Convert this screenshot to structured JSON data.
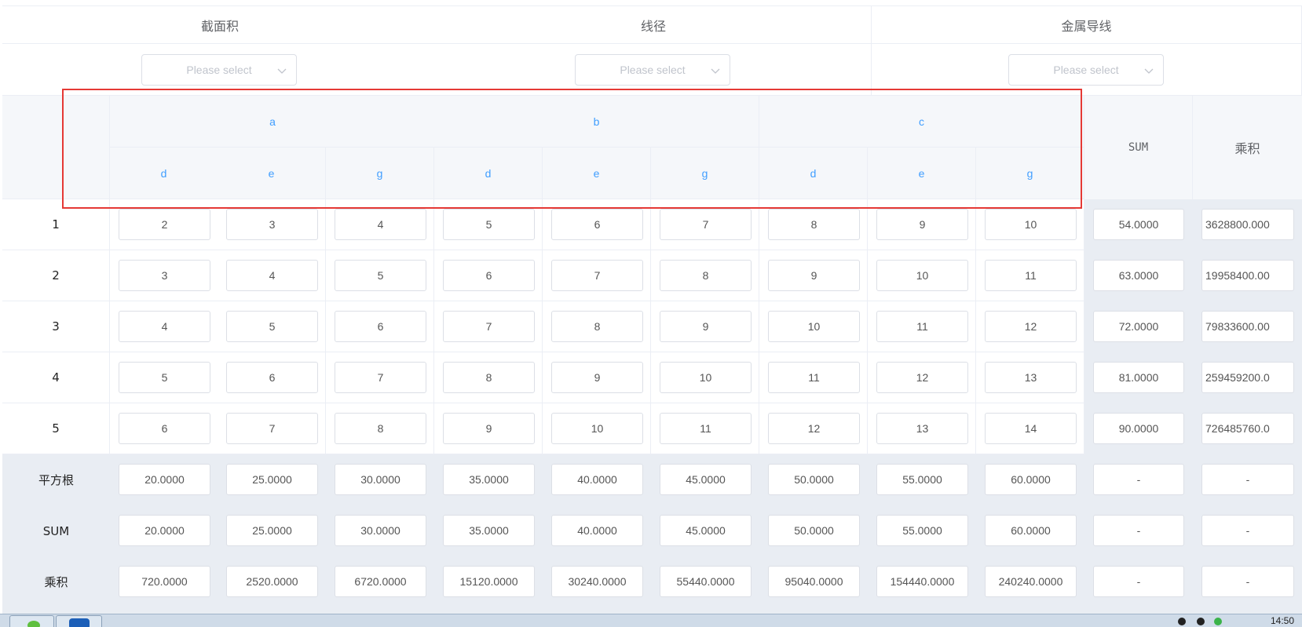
{
  "top_headers": [
    "截面积",
    "线径",
    "金属导线"
  ],
  "filter_placeholder": "Please select",
  "group_headers": [
    "a",
    "b",
    "c"
  ],
  "sub_headers": [
    "d",
    "e",
    "g",
    "d",
    "e",
    "g",
    "d",
    "e",
    "g"
  ],
  "sum_header": "SUM",
  "product_header": "乘积",
  "rows": [
    {
      "label": "1",
      "values": [
        "2",
        "3",
        "4",
        "5",
        "6",
        "7",
        "8",
        "9",
        "10"
      ],
      "sum": "54.0000",
      "product": "3628800.000"
    },
    {
      "label": "2",
      "values": [
        "3",
        "4",
        "5",
        "6",
        "7",
        "8",
        "9",
        "10",
        "11"
      ],
      "sum": "63.0000",
      "product": "19958400.00"
    },
    {
      "label": "3",
      "values": [
        "4",
        "5",
        "6",
        "7",
        "8",
        "9",
        "10",
        "11",
        "12"
      ],
      "sum": "72.0000",
      "product": "79833600.00"
    },
    {
      "label": "4",
      "values": [
        "5",
        "6",
        "7",
        "8",
        "9",
        "10",
        "11",
        "12",
        "13"
      ],
      "sum": "81.0000",
      "product": "259459200.0"
    },
    {
      "label": "5",
      "values": [
        "6",
        "7",
        "8",
        "9",
        "10",
        "11",
        "12",
        "13",
        "14"
      ],
      "sum": "90.0000",
      "product": "726485760.0"
    }
  ],
  "summary_rows": [
    {
      "label": "平方根",
      "values": [
        "20.0000",
        "25.0000",
        "30.0000",
        "35.0000",
        "40.0000",
        "45.0000",
        "50.0000",
        "55.0000",
        "60.0000"
      ],
      "sum": "-",
      "product": "-"
    },
    {
      "label": "SUM",
      "values": [
        "20.0000",
        "25.0000",
        "30.0000",
        "35.0000",
        "40.0000",
        "45.0000",
        "50.0000",
        "55.0000",
        "60.0000"
      ],
      "sum": "-",
      "product": "-"
    },
    {
      "label": "乘积",
      "values": [
        "720.0000",
        "2520.0000",
        "6720.0000",
        "15120.0000",
        "30240.0000",
        "55440.0000",
        "95040.0000",
        "154440.0000",
        "240240.0000"
      ],
      "sum": "-",
      "product": "-"
    }
  ],
  "taskbar": {
    "time": "14:50"
  },
  "colors": {
    "accent": "#409eff",
    "highlight": "#e53935",
    "summary_bg": "#e9edf3",
    "header_bg": "#f5f7fa"
  }
}
